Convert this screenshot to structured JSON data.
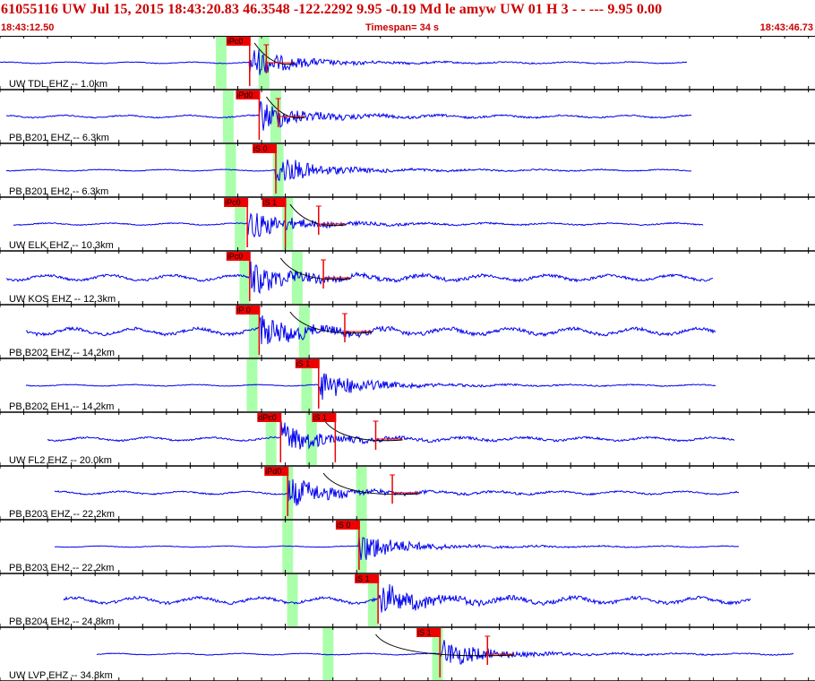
{
  "header": {
    "title": "61055116 UW Jul 15, 2015 18:43:20.83   46.3548 -122.2292  9.95 -0.19 Md le     amyw     UW 01 H    3  -  - ---  9.95 0.00",
    "start_time": "18:43:12.50",
    "timespan": "Timespan=  34 s",
    "end_time": "18:43:46.73"
  },
  "colors": {
    "trace": "#0000ee",
    "pick": "#ee0000",
    "window": "#aaffaa",
    "header_text": "#cc0000",
    "divider": "#000000",
    "fit_curve": "#000000"
  },
  "chart_data": {
    "type": "line",
    "x_unit": "s",
    "xlim": [
      0,
      34.2
    ],
    "grid": false,
    "tick_interval_s": 1,
    "channels": [
      {
        "label": "UW TDL EHZ -- 1.0km",
        "trace_start": 0,
        "trace_end": 28.9,
        "windows": [
          9.3,
          11.1
        ],
        "picks": [
          {
            "label": "iPc0",
            "t": 10.5
          }
        ],
        "coda": [
          {
            "t": 11.2,
            "curve_from": 10.7
          }
        ],
        "noise": 0.15
      },
      {
        "label": "PB B201 EHZ -- 6.3km",
        "trace_start": 0.3,
        "trace_end": 29.1,
        "windows": [
          9.6,
          11.6
        ],
        "picks": [
          {
            "label": "iPd0",
            "t": 10.9
          }
        ],
        "coda": [
          {
            "t": 11.7,
            "curve_from": 11.2
          }
        ],
        "noise": 0.25
      },
      {
        "label": "PB B201 EH2 -- 6.3km",
        "trace_start": 0.3,
        "trace_end": 29.1,
        "windows": [
          9.7,
          11.7
        ],
        "picks": [
          {
            "label": "iS 0",
            "t": 11.6
          }
        ],
        "coda": [],
        "noise": 0.15
      },
      {
        "label": "UW ELK EHZ -- 10.3km",
        "trace_start": 0.6,
        "trace_end": 29.6,
        "windows": [
          10.1,
          12.1
        ],
        "picks": [
          {
            "label": "iPc0",
            "t": 10.4
          },
          {
            "label": "iS 1",
            "t": 12.0
          }
        ],
        "coda": [
          {
            "t": 13.4,
            "curve_from": 12.2
          }
        ],
        "noise": 0.2
      },
      {
        "label": "UW KOS EHZ -- 12.3km",
        "trace_start": 0.3,
        "trace_end": 30.0,
        "windows": [
          10.3,
          12.5
        ],
        "picks": [
          {
            "label": "iPc0",
            "t": 10.5
          }
        ],
        "coda": [
          {
            "t": 13.6,
            "curve_from": 11.8
          }
        ],
        "noise": 0.55
      },
      {
        "label": "PB B202 EHZ -- 14.2km",
        "trace_start": 1.1,
        "trace_end": 30.1,
        "windows": [
          10.7,
          12.8
        ],
        "picks": [
          {
            "label": "iP 0",
            "t": 10.9
          }
        ],
        "coda": [
          {
            "t": 14.5,
            "curve_from": 12.2
          }
        ],
        "noise": 0.65
      },
      {
        "label": "PB B202 EH1 -- 14.2km",
        "trace_start": 1.1,
        "trace_end": 30.1,
        "windows": [
          10.6,
          12.9
        ],
        "picks": [
          {
            "label": "iS 1",
            "t": 13.4
          }
        ],
        "coda": [],
        "noise": 0.15
      },
      {
        "label": "UW FL2 EHZ -- 20.0km",
        "trace_start": 2.0,
        "trace_end": 30.9,
        "windows": [
          11.4,
          13.1
        ],
        "picks": [
          {
            "label": "dPc0",
            "t": 11.8
          },
          {
            "label": "iS 1",
            "t": 14.1
          }
        ],
        "coda": [
          {
            "t": 15.8,
            "curve_from": 13.6
          }
        ],
        "noise": 0.35
      },
      {
        "label": "PB B203 EHZ -- 22.2km",
        "trace_start": 2.3,
        "trace_end": 31.1,
        "windows": [
          12.1,
          15.2
        ],
        "picks": [
          {
            "label": "iPd0",
            "t": 12.1
          }
        ],
        "coda": [
          {
            "t": 16.5,
            "curve_from": 13.6
          }
        ],
        "noise": 0.3
      },
      {
        "label": "PB B203 EH2 -- 22.2km",
        "trace_start": 2.3,
        "trace_end": 31.1,
        "windows": [
          12.1,
          15.2
        ],
        "picks": [
          {
            "label": "iS 0",
            "t": 15.1
          }
        ],
        "coda": [],
        "noise": 0.12
      },
      {
        "label": "PB B204 EH2 -- 24.8km",
        "trace_start": 2.7,
        "trace_end": 31.6,
        "windows": [
          12.3,
          15.7
        ],
        "picks": [
          {
            "label": "iS 1",
            "t": 15.9
          }
        ],
        "coda": [],
        "noise": 0.6
      },
      {
        "label": "UW LVP EHZ -- 34.8km",
        "trace_start": 4.1,
        "trace_end": 33.4,
        "windows": [
          13.8,
          18.4
        ],
        "picks": [
          {
            "label": "iS 1",
            "t": 18.5
          }
        ],
        "coda": [
          {
            "t": 20.5,
            "curve_from": 15.8
          }
        ],
        "noise": 0.15
      }
    ]
  }
}
